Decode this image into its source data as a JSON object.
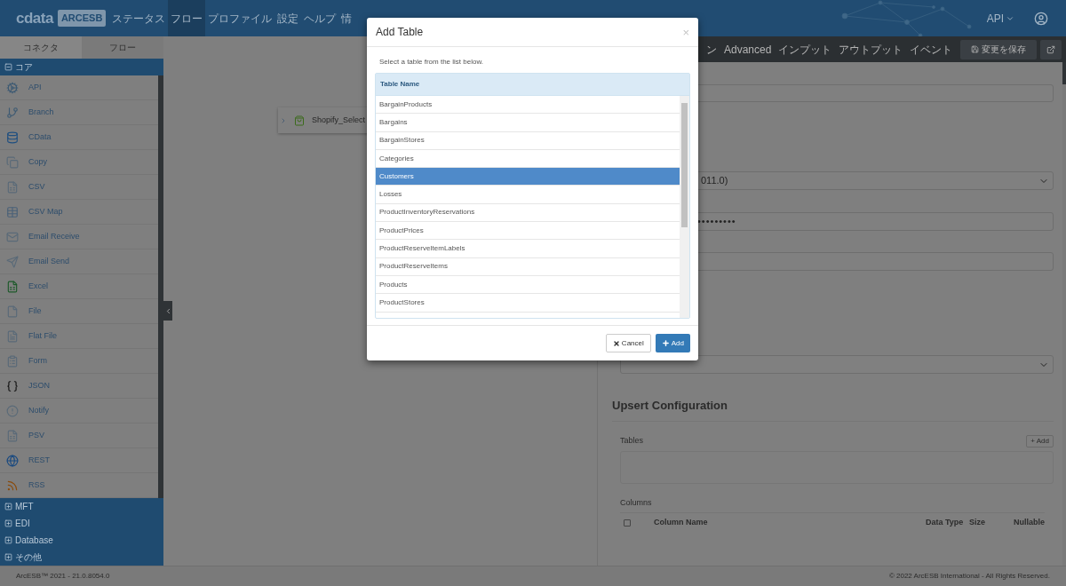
{
  "header": {
    "logo_text": "cdata",
    "logo_badge": "ARCESB",
    "nav": [
      {
        "label": "ステータス",
        "selected": false
      },
      {
        "label": "フロー",
        "selected": true
      },
      {
        "label": "プロファイル",
        "selected": false
      },
      {
        "label": "設定",
        "selected": false
      },
      {
        "label": "ヘルプ",
        "selected": false
      },
      {
        "label": "情",
        "selected": false
      }
    ],
    "user_menu": "API"
  },
  "sidebar": {
    "tabs": [
      {
        "label": "コネクタ",
        "selected": true
      },
      {
        "label": "フロー",
        "selected": false
      }
    ],
    "groups": [
      {
        "label": "コア",
        "expanded": true,
        "items": [
          "API",
          "Branch",
          "CData",
          "Copy",
          "CSV",
          "CSV Map",
          "Email Receive",
          "Email Send",
          "Excel",
          "File",
          "Flat File",
          "Form",
          "JSON",
          "Notify",
          "PSV",
          "REST",
          "RSS"
        ]
      },
      {
        "label": "MFT",
        "expanded": false
      },
      {
        "label": "EDI",
        "expanded": false
      },
      {
        "label": "Database",
        "expanded": false
      },
      {
        "label": "その他",
        "expanded": false
      }
    ]
  },
  "canvas": {
    "nodes": [
      {
        "label": "Shopify_Select"
      }
    ]
  },
  "panel": {
    "tabs": [
      {
        "label": "ン",
        "selected": false
      },
      {
        "label": "Advanced",
        "selected": false
      },
      {
        "label": "インプット",
        "selected": false
      },
      {
        "label": "アウトプット",
        "selected": false
      },
      {
        "label": "イベント",
        "selected": false
      }
    ],
    "save_button": "変更を保存",
    "fields": [
      {
        "kind": "textarea"
      },
      {
        "kind": "select",
        "value": "011.0)"
      },
      {
        "kind": "password",
        "value": "•••••••••"
      },
      {
        "kind": "text"
      },
      {
        "kind": "select"
      }
    ],
    "upsert": {
      "title": "Upsert Configuration",
      "tables_label": "Tables",
      "add_button": "+ Add",
      "columns_label": "Columns",
      "select_all_checked": false,
      "columns": [
        "Column Name",
        "Data Type",
        "Size",
        "Nullable"
      ]
    }
  },
  "footer": {
    "version": "ArcESB™ 2021 - 21.0.8054.0",
    "copyright": "© 2022 ArcESB International - All Rights Reserved."
  },
  "modal": {
    "title": "Add Table",
    "close": "×",
    "instruction": "Select a table from the list below.",
    "column": "Table Name",
    "rows": [
      {
        "name": "BargainProducts",
        "selected": false
      },
      {
        "name": "Bargains",
        "selected": false
      },
      {
        "name": "BargainStores",
        "selected": false
      },
      {
        "name": "Categories",
        "selected": false
      },
      {
        "name": "Customers",
        "selected": true
      },
      {
        "name": "Losses",
        "selected": false
      },
      {
        "name": "ProductInventoryReservations",
        "selected": false
      },
      {
        "name": "ProductPrices",
        "selected": false
      },
      {
        "name": "ProductReserveItemLabels",
        "selected": false
      },
      {
        "name": "ProductReserveItems",
        "selected": false
      },
      {
        "name": "Products",
        "selected": false
      },
      {
        "name": "ProductStores",
        "selected": false
      }
    ],
    "cancel": "Cancel",
    "add": "Add"
  }
}
